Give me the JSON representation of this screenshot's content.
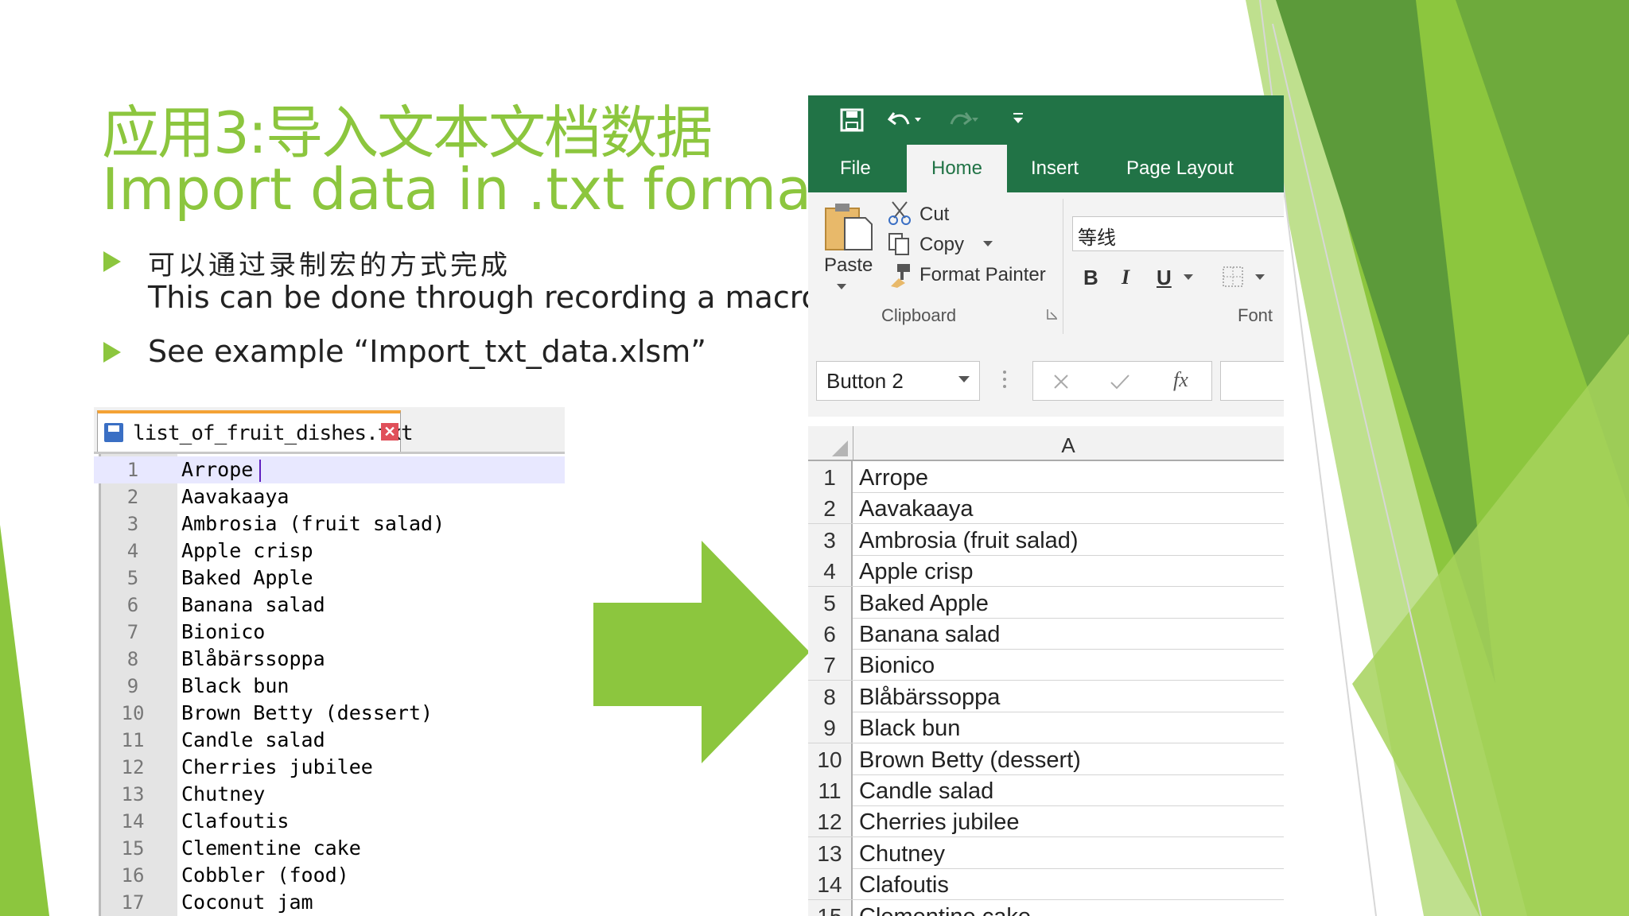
{
  "slide": {
    "title_cn": "应用3:导入文本文档数据",
    "title_en": "Import data in .txt format",
    "bullets": [
      {
        "line1": "可以通过录制宏的方式完成",
        "line2": "This can be done through recording a macro."
      },
      {
        "line1": "See example “Import_txt_data.xlsm”"
      }
    ],
    "colors": {
      "accent": "#8cc63e",
      "dark_green": "#5c9a3a",
      "excel_green": "#217346"
    }
  },
  "notepad": {
    "tab_title": "list_of_fruit_dishes.txt",
    "close_glyph": "✕",
    "lines": [
      {
        "num": "1",
        "text": "Arrope"
      },
      {
        "num": "2",
        "text": "Aavakaaya"
      },
      {
        "num": "3",
        "text": "Ambrosia (fruit salad)"
      },
      {
        "num": "4",
        "text": "Apple crisp"
      },
      {
        "num": "5",
        "text": "Baked Apple"
      },
      {
        "num": "6",
        "text": "Banana salad"
      },
      {
        "num": "7",
        "text": "Bionico"
      },
      {
        "num": "8",
        "text": "Blåbärssoppa"
      },
      {
        "num": "9",
        "text": "Black bun"
      },
      {
        "num": "10",
        "text": "Brown Betty (dessert)"
      },
      {
        "num": "11",
        "text": "Candle salad"
      },
      {
        "num": "12",
        "text": "Cherries jubilee"
      },
      {
        "num": "13",
        "text": "Chutney"
      },
      {
        "num": "14",
        "text": "Clafoutis"
      },
      {
        "num": "15",
        "text": "Clementine cake"
      },
      {
        "num": "16",
        "text": "Cobbler (food)"
      },
      {
        "num": "17",
        "text": "Coconut jam"
      }
    ]
  },
  "excel": {
    "tabs": {
      "file": "File",
      "home": "Home",
      "insert": "Insert",
      "page_layout": "Page Layout"
    },
    "clipboard": {
      "paste": "Paste",
      "cut": "Cut",
      "copy": "Copy",
      "format_painter": "Format Painter",
      "group": "Clipboard"
    },
    "font": {
      "name": "等线",
      "bold": "B",
      "italic": "I",
      "underline": "U",
      "group": "Font"
    },
    "name_box": "Button 2",
    "fx": "fx",
    "column_header": "A",
    "rows": [
      {
        "num": "1",
        "value": "Arrope"
      },
      {
        "num": "2",
        "value": "Aavakaaya"
      },
      {
        "num": "3",
        "value": "Ambrosia (fruit salad)"
      },
      {
        "num": "4",
        "value": "Apple crisp"
      },
      {
        "num": "5",
        "value": "Baked Apple"
      },
      {
        "num": "6",
        "value": "Banana salad"
      },
      {
        "num": "7",
        "value": "Bionico"
      },
      {
        "num": "8",
        "value": "Blåbärssoppa"
      },
      {
        "num": "9",
        "value": "Black bun"
      },
      {
        "num": "10",
        "value": "Brown Betty (dessert)"
      },
      {
        "num": "11",
        "value": "Candle salad"
      },
      {
        "num": "12",
        "value": "Cherries jubilee"
      },
      {
        "num": "13",
        "value": "Chutney"
      },
      {
        "num": "14",
        "value": "Clafoutis"
      },
      {
        "num": "15",
        "value": "Clementine cake"
      }
    ]
  }
}
